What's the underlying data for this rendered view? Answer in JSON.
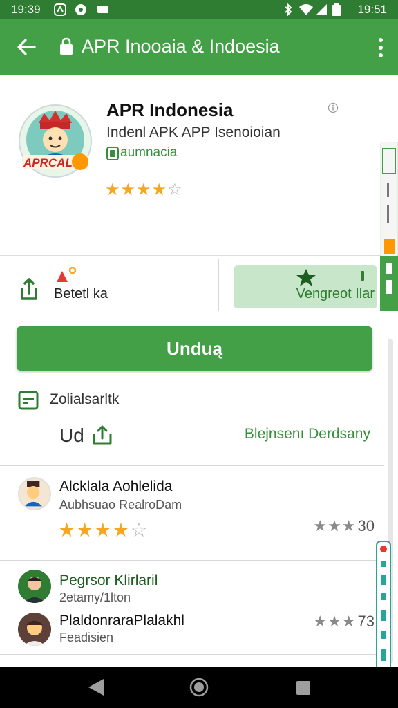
{
  "status_bar": {
    "time_left": "19:39",
    "time_right": "19:51",
    "icons": [
      "notification-icon",
      "location-icon",
      "message-icon",
      "bluetooth-icon",
      "wifi-icon",
      "signal-icon",
      "battery-icon"
    ]
  },
  "app_bar": {
    "title": "APR Inooaia & Indoesia",
    "icons": [
      "back-arrow-icon",
      "lock-icon",
      "more-vert-icon"
    ]
  },
  "app_header": {
    "name": "APR Indonesia",
    "subtitle": "Indenl APK APP Isenoioian",
    "developer": "aumnacia",
    "icon_label": "APRCAL",
    "rating": 4,
    "rating_max": 5
  },
  "actions": {
    "share_label": "Betetl ka",
    "wishlist_label": "Vengreot Ilar"
  },
  "install": {
    "label": "Unduą"
  },
  "info": {
    "title": "Zolialsarltk",
    "ud_label": "Ud",
    "link": "Blejnsenı Derdsany"
  },
  "reviews": [
    {
      "name": "Alcklala Aohlelida",
      "subtitle": "Aubhsuao RealroDam",
      "rating": 4,
      "rating_max": 5,
      "score": "30",
      "score_stars": 3
    },
    {
      "name": "Pegrsor Klirlaril",
      "subtitle": "2etamy/1lton"
    },
    {
      "name": "PlaldonraraPlalakhl",
      "subtitle": "Feadisien",
      "score": "73",
      "score_stars": 3
    }
  ],
  "colors": {
    "status_bar": "#2e7d32",
    "app_bar": "#43a047",
    "accent": "#388e3c",
    "wishlist_bg": "#c8e6c9",
    "star": "#f5a623",
    "nav_bar": "#000000"
  }
}
